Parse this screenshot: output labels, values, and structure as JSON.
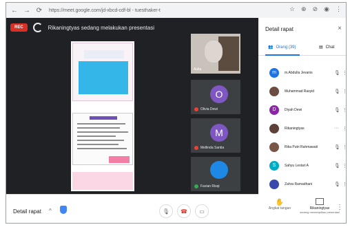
{
  "browser": {
    "back_icon": "←",
    "forward_icon": "→",
    "reload_icon": "⟳",
    "url": "https://meet.google.com/jd-xbcd-cdf-bl - tuesthaker-t",
    "icons": [
      "☆",
      "⊕",
      "⊘",
      "◉",
      "⋮"
    ]
  },
  "meeting": {
    "rec_label": "REC",
    "presenting_text": "Rikaningtyas sedang melakukan presentasi",
    "tiles": [
      {
        "name": "Aulia",
        "type": "photo"
      },
      {
        "name": "Olivia Dewi",
        "avatar": "O",
        "mic": "muted"
      },
      {
        "name": "Mellinda Santia",
        "avatar": "M",
        "mic": "muted"
      },
      {
        "name": "Favian Risqi",
        "type": "photo",
        "mic": "active"
      }
    ]
  },
  "bottombar": {
    "details_label": "Detail rapat",
    "caret": "^",
    "mic_icon": "🎙",
    "end_icon": "☎",
    "captions_icon": "▭",
    "raise_label": "Angkat tangan",
    "present_title": "Rikaningtyas",
    "present_sub": "sedang menampilkan presentasi",
    "more_icon": "⋮"
  },
  "panel": {
    "title": "Detail rapat",
    "close_icon": "×",
    "tab_people": "Orang (39)",
    "tab_chat": "Chat",
    "participants": [
      {
        "name": "m.Abdulla Jevanis",
        "initial": "m",
        "color": "#1a73e8"
      },
      {
        "name": "Muhammad Rasyid",
        "initial": "",
        "color": "#6d4c41"
      },
      {
        "name": "Diyah Dewi",
        "initial": "D",
        "color": "#8e24aa"
      },
      {
        "name": "Rikaningtyas",
        "initial": "",
        "color": "#5d4037"
      },
      {
        "name": "Rika Putri Rahmawati",
        "initial": "",
        "color": "#795548"
      },
      {
        "name": "Sahyu Lestari A",
        "initial": "S",
        "color": "#00acc1"
      },
      {
        "name": "Zahra Ramadhani",
        "initial": "",
        "color": "#3949ab"
      }
    ]
  }
}
